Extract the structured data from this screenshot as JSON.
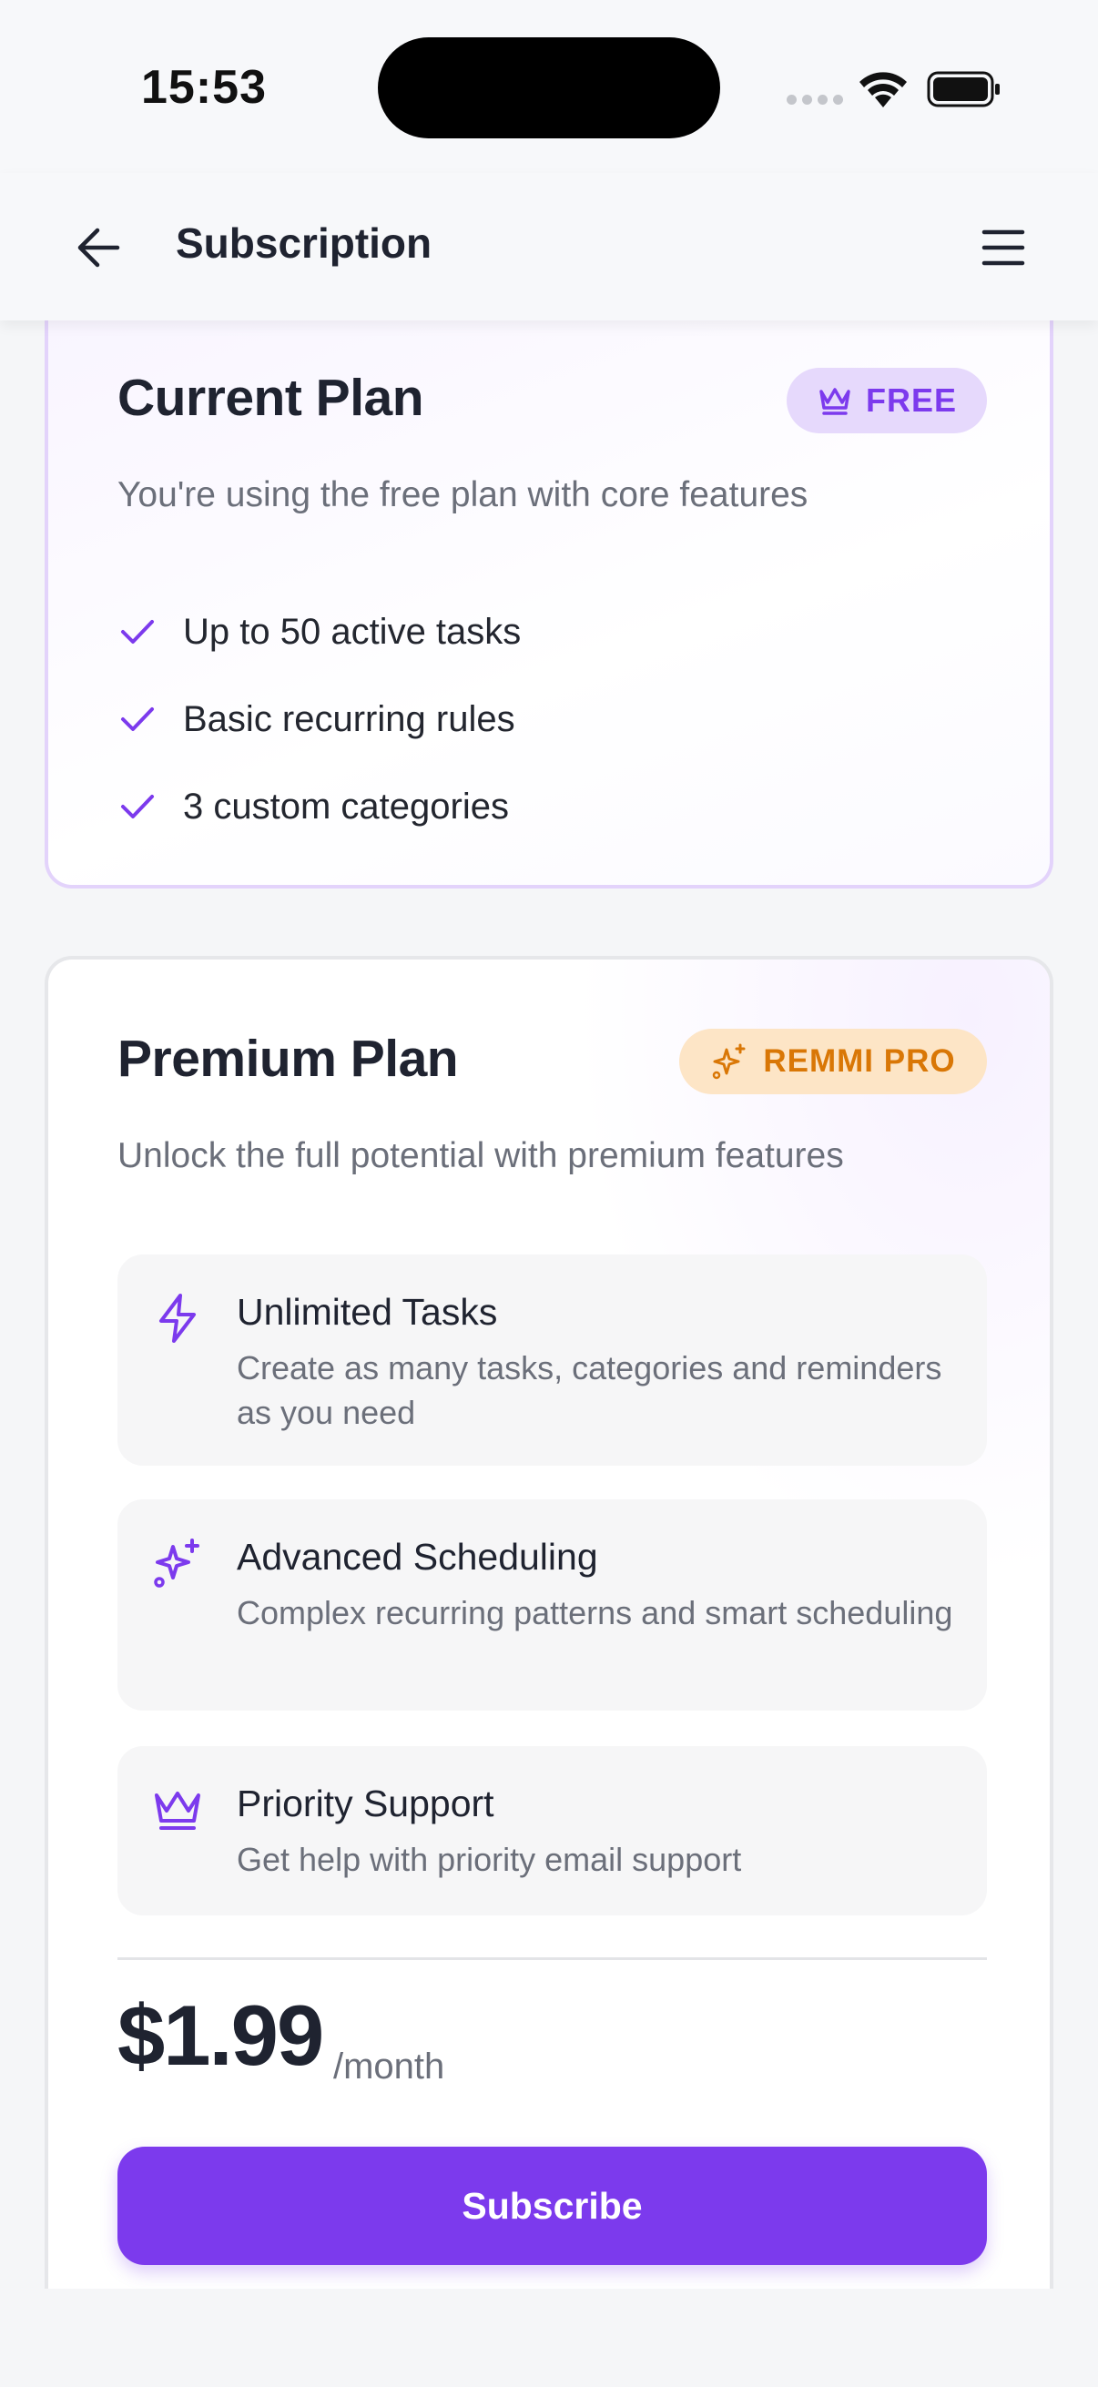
{
  "status_bar": {
    "time": "15:53"
  },
  "header": {
    "title": "Subscription"
  },
  "current_plan": {
    "title": "Current Plan",
    "badge": "FREE",
    "description": "You're using the free plan with core features",
    "features": [
      "Up to 50 active tasks",
      "Basic recurring rules",
      "3 custom categories"
    ]
  },
  "premium_plan": {
    "title": "Premium Plan",
    "badge": "REMMI PRO",
    "description": "Unlock the full potential with premium features",
    "features": [
      {
        "icon": "lightning-icon",
        "title": "Unlimited Tasks",
        "description": "Create as many tasks, categories and reminders as you need"
      },
      {
        "icon": "sparkles-icon",
        "title": "Advanced Scheduling",
        "description": "Complex recurring patterns and smart scheduling"
      },
      {
        "icon": "crown-icon",
        "title": "Priority Support",
        "description": "Get help with priority email support"
      }
    ],
    "price": "$1.99",
    "period": "/month",
    "cta": "Subscribe"
  },
  "colors": {
    "accent": "#7c3aed",
    "free_badge_bg": "#e6d9fc",
    "pro_badge_bg": "#fde5c6",
    "pro_badge_text": "#d97706"
  }
}
